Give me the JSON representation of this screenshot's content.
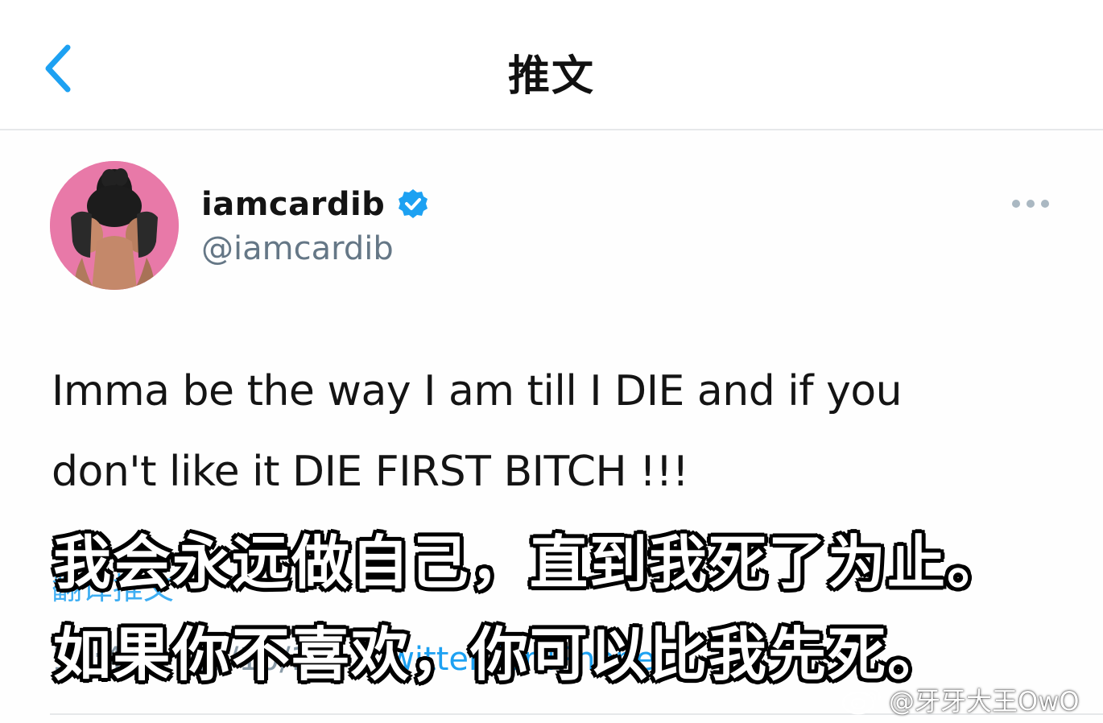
{
  "header": {
    "title": "推文",
    "back_icon": "chevron-left-icon"
  },
  "tweet": {
    "display_name": "iamcardib",
    "handle": "@iamcardib",
    "verified": true,
    "text_line_1": "Imma be the way I am till I DIE and if you",
    "text_line_2": "don't like it DIE FIRST BITCH !!!",
    "translate_label": "翻译推文",
    "time": "12:42",
    "date": "18/10/18",
    "source": "Twitter for iPhone"
  },
  "subtitles": {
    "line_1": "我会永远做自己，直到我死了为止。",
    "line_2": "如果你不喜欢，你可以比我先死。"
  },
  "watermark": {
    "text": "@牙牙大王OwO",
    "logo_icon": "weibo-logo-icon"
  },
  "colors": {
    "accent": "#1da1f2",
    "verified": "#1da1f2",
    "avatar_bg": "#e879a8",
    "handle": "#657786"
  }
}
